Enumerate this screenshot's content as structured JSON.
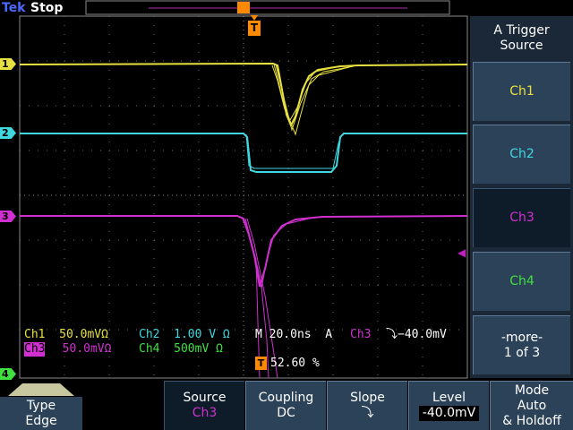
{
  "status": {
    "brand": "Tek",
    "state": "Stop"
  },
  "trigger_marker": "T",
  "side_menu": {
    "title_line1": "A Trigger",
    "title_line2": "Source",
    "items": [
      {
        "label": "Ch1",
        "color": "#e8e040"
      },
      {
        "label": "Ch2",
        "color": "#40d8e0"
      },
      {
        "label": "Ch3",
        "color": "#d030d0",
        "selected": true
      },
      {
        "label": "Ch4",
        "color": "#40e040"
      },
      {
        "label": "-more-",
        "label2": "1 of 3",
        "color": "#ffffff"
      }
    ]
  },
  "bottom_menu": {
    "type": {
      "label": "Type",
      "value": "Edge"
    },
    "source": {
      "label": "Source",
      "value": "Ch3"
    },
    "coupling": {
      "label": "Coupling",
      "value": "DC"
    },
    "slope": {
      "label": "Slope",
      "value": "⤵"
    },
    "level": {
      "label": "Level",
      "value": "-40.0mV"
    },
    "mode": {
      "label": "Mode",
      "value": "Auto",
      "value2": "& Holdoff"
    }
  },
  "channel_markers": [
    {
      "label": "1",
      "color": "#e8e040"
    },
    {
      "label": "2",
      "color": "#40d8e0"
    },
    {
      "label": "3",
      "color": "#d030d0"
    },
    {
      "label": "4",
      "color": "#40e040"
    }
  ],
  "readouts": {
    "ch1": "Ch1  50.0mVΩ",
    "ch2": "Ch2  1.00 V Ω",
    "ch3": "Ch3",
    "ch3_scale": "  50.0mVΩ",
    "ch4": "Ch4  500mV Ω",
    "timebase": "M 20.0ns  A",
    "trig_src": "Ch3",
    "trig_level": "⤵−40.0mV",
    "trig_pos_value": "52.60 %"
  },
  "colors": {
    "ch1": "#e8e040",
    "ch2": "#40d8e0",
    "ch3": "#d030d0",
    "ch4": "#40e040",
    "trigger": "#ff8a00",
    "menu": "#2c4258"
  }
}
